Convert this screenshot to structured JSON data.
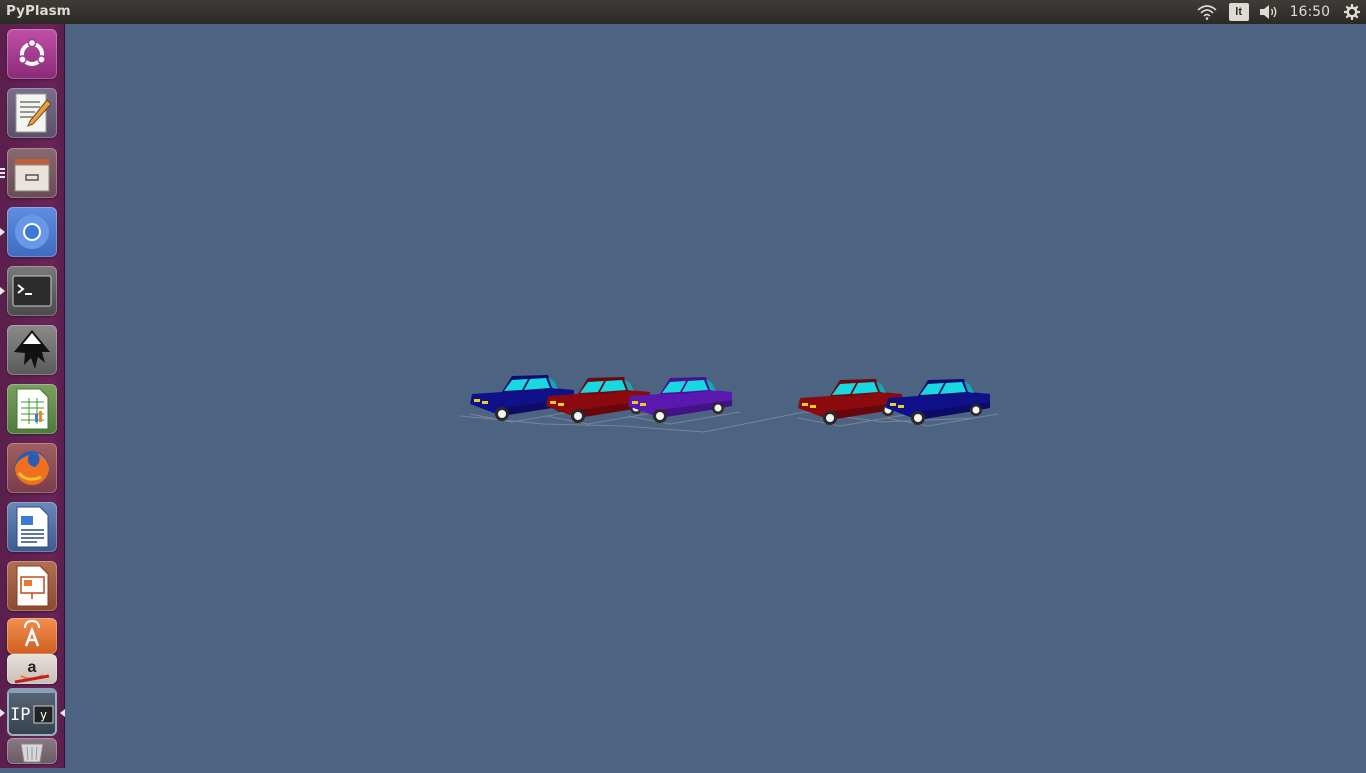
{
  "window": {
    "title": "PyPlasm"
  },
  "panel": {
    "keyboard_layout": "lt",
    "clock": "16:50"
  },
  "indicators": [
    {
      "icon": "wifi-icon"
    },
    {
      "icon": "keyboard-layout-icon"
    },
    {
      "icon": "volume-icon"
    },
    {
      "icon": "clock"
    },
    {
      "icon": "gear-icon"
    }
  ],
  "launcher": {
    "items": [
      {
        "name": "ubuntu-dash",
        "icon": "ubuntu-logo-icon"
      },
      {
        "name": "text-editor",
        "icon": "text-editor-icon"
      },
      {
        "name": "files",
        "icon": "files-cabinet-icon"
      },
      {
        "name": "chromium",
        "icon": "chromium-icon"
      },
      {
        "name": "terminal",
        "icon": "terminal-icon"
      },
      {
        "name": "inkscape",
        "icon": "inkscape-icon"
      },
      {
        "name": "libreoffice-calc",
        "icon": "spreadsheet-icon"
      },
      {
        "name": "firefox",
        "icon": "firefox-icon"
      },
      {
        "name": "libreoffice-writer",
        "icon": "writer-icon"
      },
      {
        "name": "libreoffice-impress",
        "icon": "impress-icon"
      },
      {
        "name": "software-center",
        "icon": "shopping-bag-icon"
      },
      {
        "name": "amazon",
        "icon": "amazon-icon"
      },
      {
        "name": "ipython",
        "icon": "ipython-icon",
        "label": "IP[y]"
      },
      {
        "name": "trash",
        "icon": "trash-icon"
      }
    ]
  },
  "colors": {
    "desktop_bg": "#4c6482",
    "panel_bg": "#2b2a27",
    "launcher_bg": "#6b2459",
    "car_blue": "#10108a",
    "car_red": "#8a0a10",
    "car_purple": "#5a18b0",
    "car_window": "#18d8e0"
  },
  "scene": {
    "cars": [
      {
        "name": "car-1",
        "color": "car_blue"
      },
      {
        "name": "car-2",
        "color": "car_red"
      },
      {
        "name": "car-3",
        "color": "car_purple"
      },
      {
        "name": "car-4",
        "color": "car_red"
      },
      {
        "name": "car-5",
        "color": "car_blue"
      }
    ]
  }
}
